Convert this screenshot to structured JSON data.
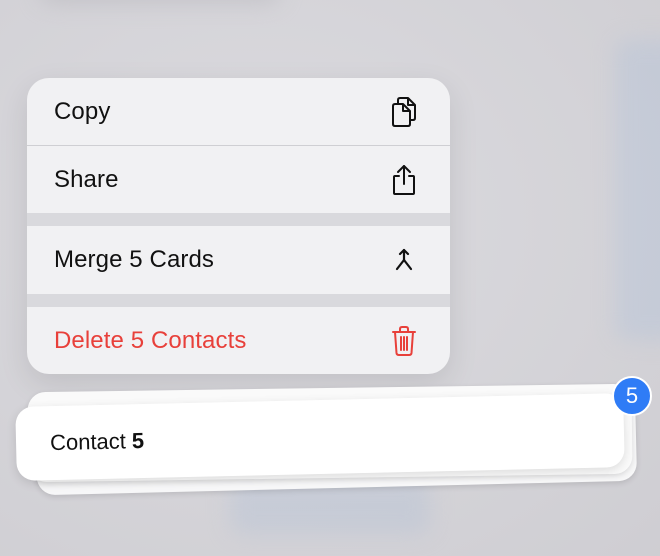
{
  "menu": {
    "items": [
      {
        "label": "Copy",
        "icon": "copy-icon"
      },
      {
        "label": "Share",
        "icon": "share-icon"
      },
      {
        "label": "Merge 5 Cards",
        "icon": "merge-icon"
      },
      {
        "label": "Delete 5 Contacts",
        "icon": "trash-icon",
        "destructive": true
      }
    ],
    "destructive_color": "#e8403a"
  },
  "card": {
    "label": "Contact",
    "number": "5"
  },
  "badge": {
    "count": "5",
    "color": "#2f7cf6"
  }
}
